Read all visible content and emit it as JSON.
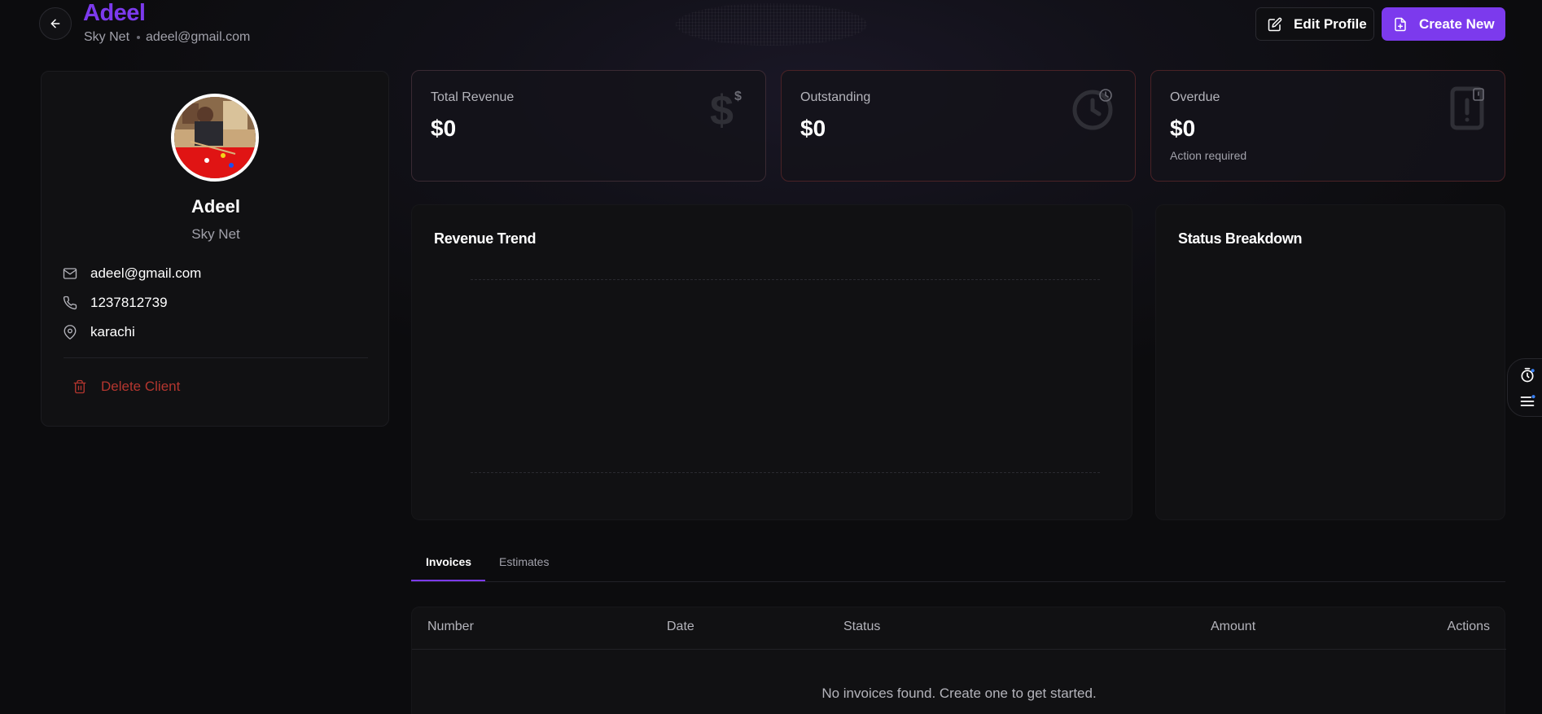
{
  "header": {
    "client_name": "Adeel",
    "company": "Sky Net",
    "email": "adeel@gmail.com",
    "edit_label": "Edit Profile",
    "create_label": "Create New"
  },
  "profile": {
    "name": "Adeel",
    "company": "Sky Net",
    "email": "adeel@gmail.com",
    "phone": "1237812739",
    "location": "karachi",
    "delete_label": "Delete Client"
  },
  "stats": [
    {
      "label": "Total Revenue",
      "value": "$0",
      "icon": "dollar-icon"
    },
    {
      "label": "Outstanding",
      "value": "$0",
      "icon": "clock-icon"
    },
    {
      "label": "Overdue",
      "value": "$0",
      "note": "Action required",
      "icon": "alert-file-icon"
    }
  ],
  "charts": {
    "revenue_title": "Revenue Trend",
    "status_title": "Status Breakdown"
  },
  "tabs": [
    {
      "label": "Invoices",
      "active": true
    },
    {
      "label": "Estimates",
      "active": false
    }
  ],
  "table": {
    "columns": [
      "Number",
      "Date",
      "Status",
      "Amount",
      "Actions"
    ],
    "empty_message": "No invoices found. Create one to get started."
  },
  "colors": {
    "accent": "#7c3aed",
    "danger": "#b4362f",
    "background": "#0c0c0e",
    "card": "#111113"
  }
}
